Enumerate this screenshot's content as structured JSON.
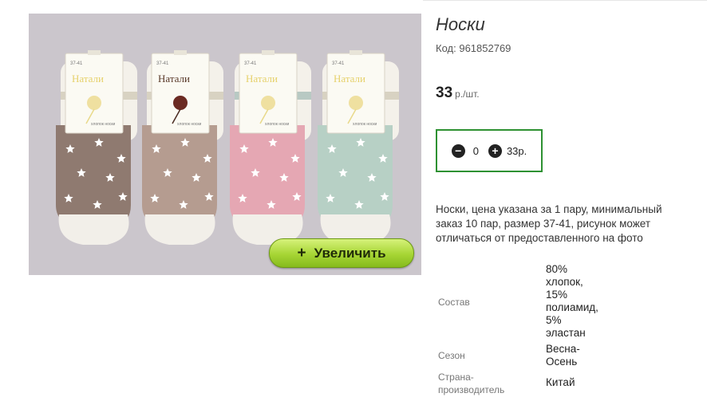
{
  "product": {
    "title": "Носки",
    "code_label": "Код:",
    "code_value": "961852769",
    "price_value": "33",
    "price_unit": "р./шт.",
    "description": "Носки, цена указана за 1 пару, минимальный заказ 10 пар, размер 37-41, рисунок может отличаться от предоставленного на фото"
  },
  "cart": {
    "minus_icon": "minus-circle-icon",
    "plus_icon": "plus-circle-icon",
    "quantity": "0",
    "total": "33р."
  },
  "image": {
    "zoom_label": "Увеличить",
    "zoom_icon": "+",
    "brand": "Натали",
    "size": "37-41",
    "small_print": "хлопок носки"
  },
  "properties": [
    {
      "label": "Состав",
      "lines": [
        "80%",
        "хлопок,",
        "15%",
        "полиамид,",
        "5%",
        "эластан"
      ]
    },
    {
      "label": "Сезон",
      "lines": [
        "Весна-",
        "Осень"
      ]
    },
    {
      "label_lines": [
        "Страна-",
        "производитель"
      ],
      "lines": [
        "Китай"
      ]
    }
  ],
  "colors": {
    "accent_green": "#2e9132",
    "button_green": "#a6d534",
    "sock_colors": [
      "#8f7a70",
      "#b59c90",
      "#e5a7b3",
      "#b7d0c5"
    ]
  }
}
